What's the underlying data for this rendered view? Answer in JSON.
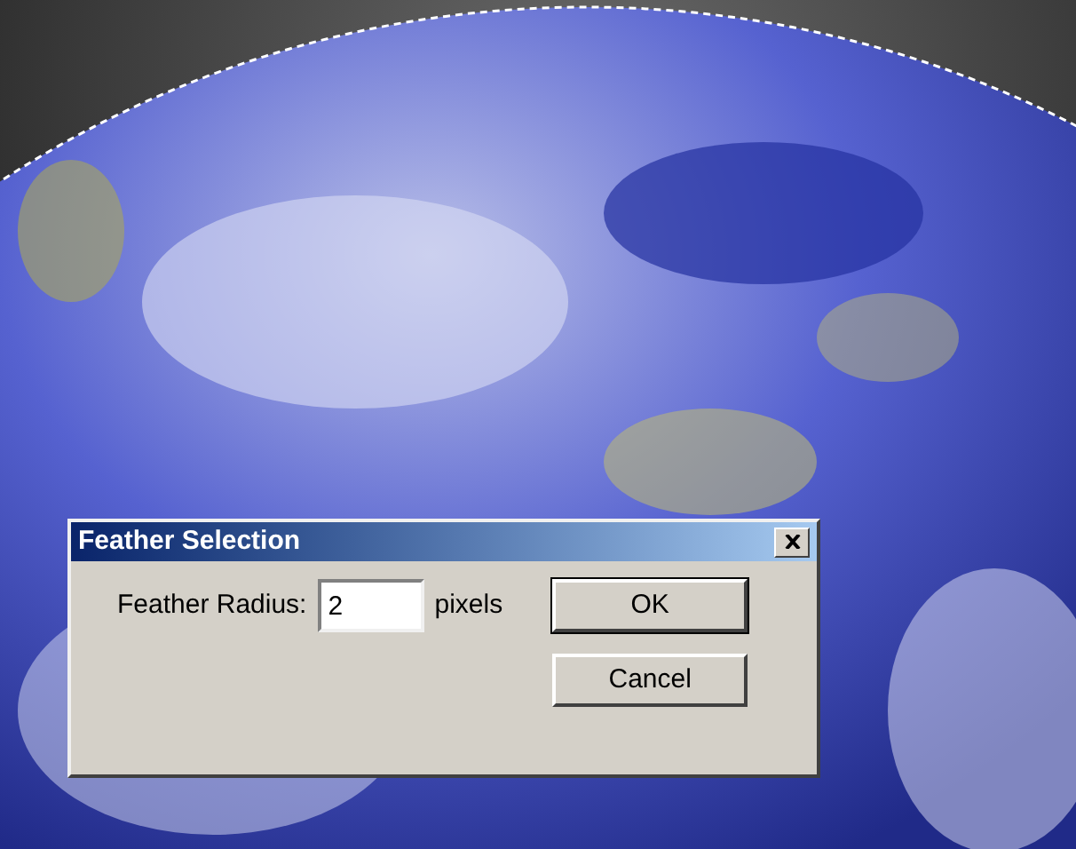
{
  "dialog": {
    "title": "Feather Selection",
    "field_label": "Feather Radius:",
    "field_value": "2",
    "unit": "pixels",
    "buttons": [
      {
        "label": "OK",
        "default": true
      },
      {
        "label": "Cancel",
        "default": false
      }
    ]
  }
}
